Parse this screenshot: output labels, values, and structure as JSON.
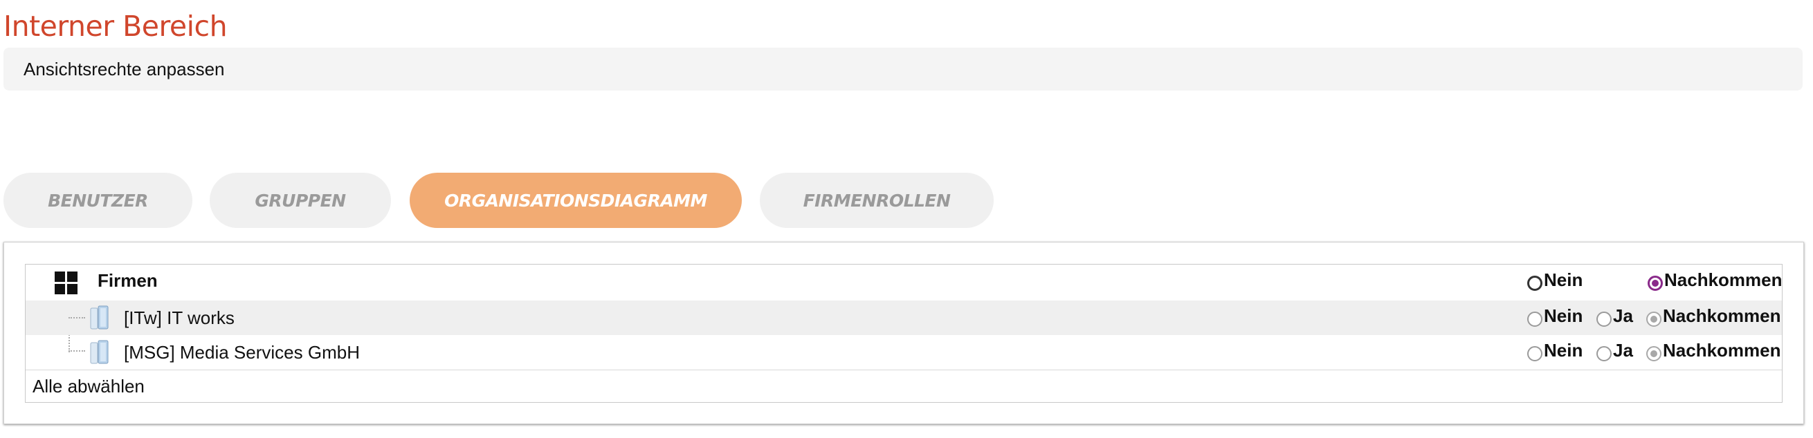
{
  "header": {
    "title": "Interner Bereich",
    "subtitle": "Ansichtsrechte anpassen"
  },
  "tabs": [
    {
      "label": "BENUTZER",
      "active": false
    },
    {
      "label": "GRUPPEN",
      "active": false
    },
    {
      "label": "ORGANISATIONSDIAGRAMM",
      "active": true
    },
    {
      "label": "FIRMENROLLEN",
      "active": false
    }
  ],
  "tree": {
    "root": {
      "label": "Firmen",
      "icon": "grid-icon",
      "options": {
        "nein": "Nein",
        "nachkommen": "Nachkommen"
      },
      "selected": "Nachkommen"
    },
    "nodes": [
      {
        "label": "[ITw] IT works",
        "icon": "folder-icon",
        "options": {
          "nein": "Nein",
          "ja": "Ja",
          "nachkommen": "Nachkommen"
        },
        "selected": "Nachkommen"
      },
      {
        "label": "[MSG] Media Services GmbH",
        "icon": "folder-icon",
        "options": {
          "nein": "Nein",
          "ja": "Ja",
          "nachkommen": "Nachkommen"
        },
        "selected": "Nachkommen"
      }
    ],
    "deselect_all": "Alle abwählen"
  },
  "colors": {
    "title": "#d0462c",
    "active_tab": "#f2ab73",
    "selected_radio": "#8a2a8a"
  }
}
